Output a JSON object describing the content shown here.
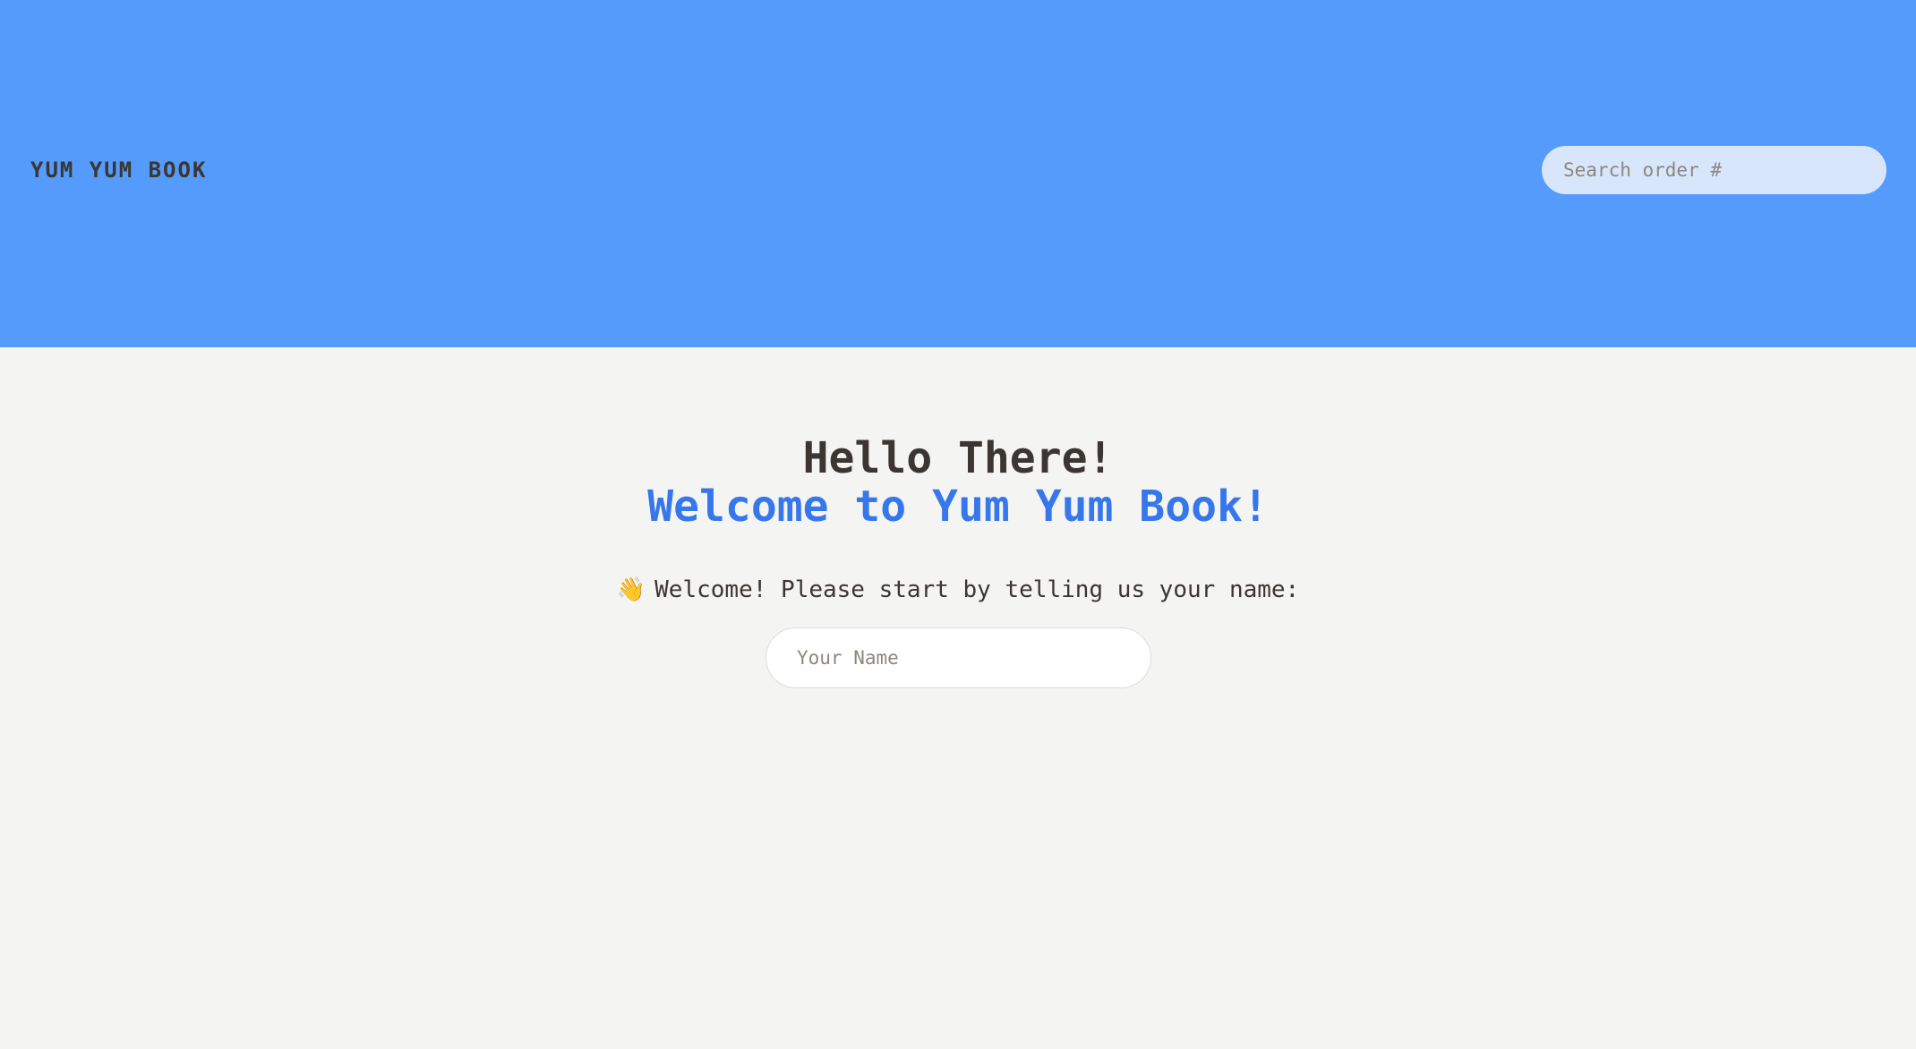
{
  "header": {
    "brand": "YUM YUM BOOK",
    "search": {
      "placeholder": "Search order #",
      "value": ""
    }
  },
  "main": {
    "greeting": "Hello There!",
    "welcome": "Welcome to Yum Yum Book!",
    "prompt_icon": "👋",
    "prompt": "Welcome! Please start by telling us your name:",
    "name_input": {
      "placeholder": "Your Name",
      "value": ""
    }
  },
  "colors": {
    "header_bg": "#559bfb",
    "page_bg": "#f4f4f3",
    "accent": "#3677eb",
    "text": "#3b3631",
    "search_bg": "#d8e6fb"
  }
}
